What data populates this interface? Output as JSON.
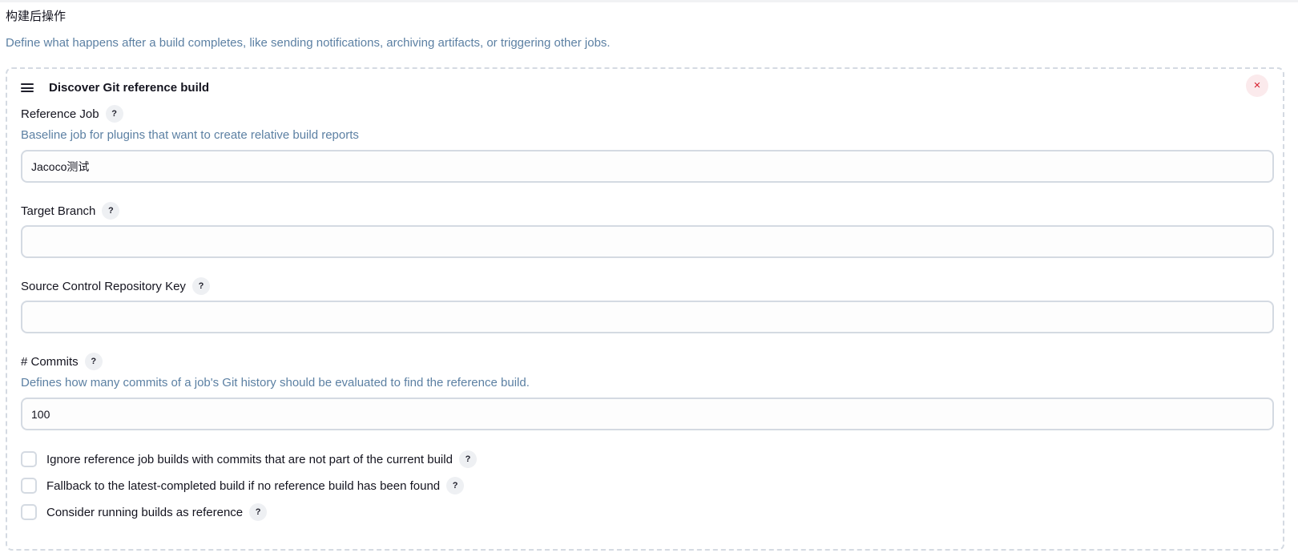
{
  "section": {
    "title": "构建后操作",
    "description": "Define what happens after a build completes, like sending notifications, archiving artifacts, or triggering other jobs."
  },
  "card": {
    "title": "Discover Git reference build",
    "close_label": "×"
  },
  "help_label": "?",
  "fields": {
    "reference_job": {
      "label": "Reference Job",
      "description": "Baseline job for plugins that want to create relative build reports",
      "value": "Jacoco测试"
    },
    "target_branch": {
      "label": "Target Branch",
      "value": ""
    },
    "scm_key": {
      "label": "Source Control Repository Key",
      "value": ""
    },
    "commits": {
      "label": "# Commits",
      "description": "Defines how many commits of a job's Git history should be evaluated to find the reference build.",
      "value": "100"
    }
  },
  "checkboxes": [
    {
      "label": "Ignore reference job builds with commits that are not part of the current build",
      "checked": false
    },
    {
      "label": "Fallback to the latest-completed build if no reference build has been found",
      "checked": false
    },
    {
      "label": "Consider running builds as reference",
      "checked": false
    }
  ],
  "colors": {
    "text": "#14141f",
    "description": "#5c80a3",
    "border": "#d4dae2",
    "close_bg": "#fbeaec",
    "close_fg": "#d61d2c"
  }
}
